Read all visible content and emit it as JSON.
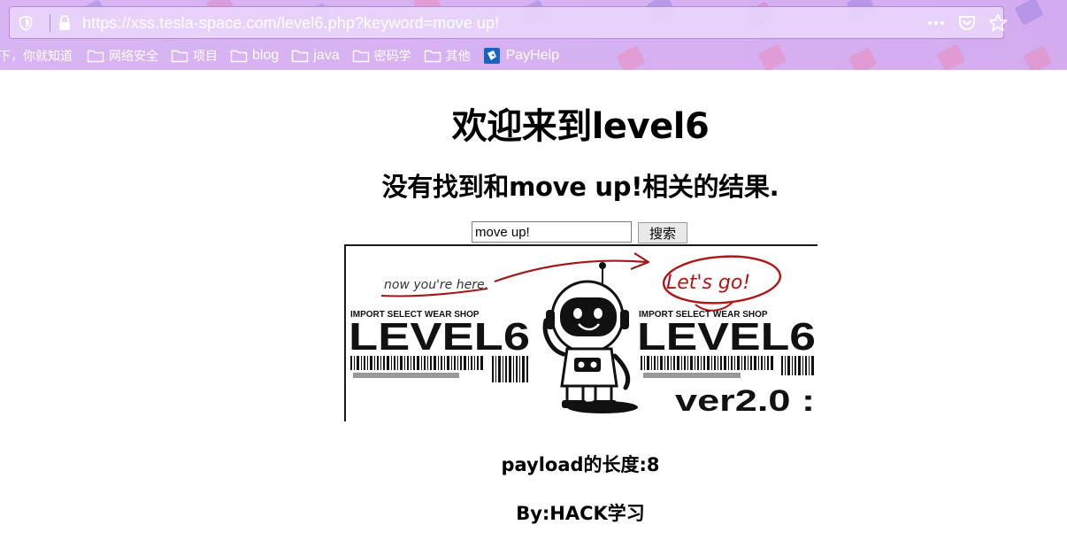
{
  "browser": {
    "url": "https://xss.tesla-space.com/level6.php?keyword=move up!",
    "bookmarks": {
      "first": "下，你就知道",
      "folders": [
        "网络安全",
        "项目",
        "blog",
        "java",
        "密码学",
        "其他"
      ],
      "payhelp": "PayHelp"
    }
  },
  "page": {
    "title": "欢迎来到level6",
    "result": "没有找到和move up!相关的结果.",
    "search": {
      "value": "move up!",
      "button": "搜索"
    },
    "banner": {
      "note_left": "now you're here.",
      "note_right": "Let's go!",
      "shop_left": "IMPORT SELECT WEAR SHOP",
      "shop_right": "IMPORT SELECT WEAR SHOP",
      "logo_left": "LEVEL6",
      "logo_right": "LEVEL6",
      "version": "ver2.0 :"
    },
    "payload": "payload的长度:8",
    "byline": "By:HACK学习"
  }
}
